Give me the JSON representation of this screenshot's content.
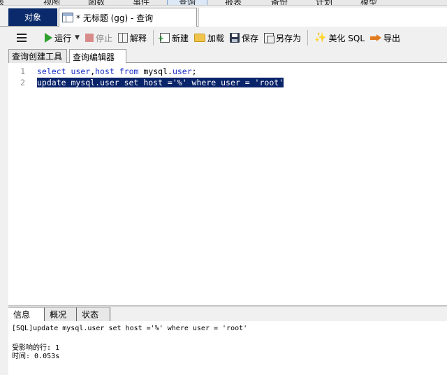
{
  "top_menu": {
    "items": [
      "表",
      "视图",
      "函数",
      "事件",
      "查询",
      "报表",
      "备份",
      "计划",
      "模型"
    ],
    "active_index": 4
  },
  "tabs": {
    "object_label": "对象",
    "query_tab_title": "* 无标题 (gg) - 查询"
  },
  "toolbar": {
    "run_label": "运行",
    "stop_label": "停止",
    "explain_label": "解释",
    "new_label": "新建",
    "load_label": "加载",
    "save_label": "保存",
    "save_as_label": "另存为",
    "beautify_label": "美化 SQL",
    "export_label": "导出"
  },
  "subtabs": {
    "builder_label": "查询创建工具",
    "editor_label": "查询编辑器"
  },
  "editor": {
    "line_numbers": [
      "1",
      "2"
    ],
    "line1": {
      "select": "select",
      "user": "user",
      "comma": ",",
      "host": "host",
      "from": "from",
      "space": " ",
      "mysql": "mysql.",
      "tbl": "user",
      "semi": ";"
    },
    "line2": "update mysql.user set host ='%' where user = 'root'"
  },
  "bottom_tabs": {
    "info_label": "信息",
    "overview_label": "概况",
    "status_label": "状态"
  },
  "output": {
    "sql_line": "[SQL]update mysql.user set host ='%' where user = 'root'",
    "affected_rows": "受影响的行: 1",
    "time": "时间: 0.053s"
  },
  "colors": {
    "keyword": "#1a2fc8",
    "selection": "#0a246a",
    "object_tab": "#0a2a6b"
  }
}
